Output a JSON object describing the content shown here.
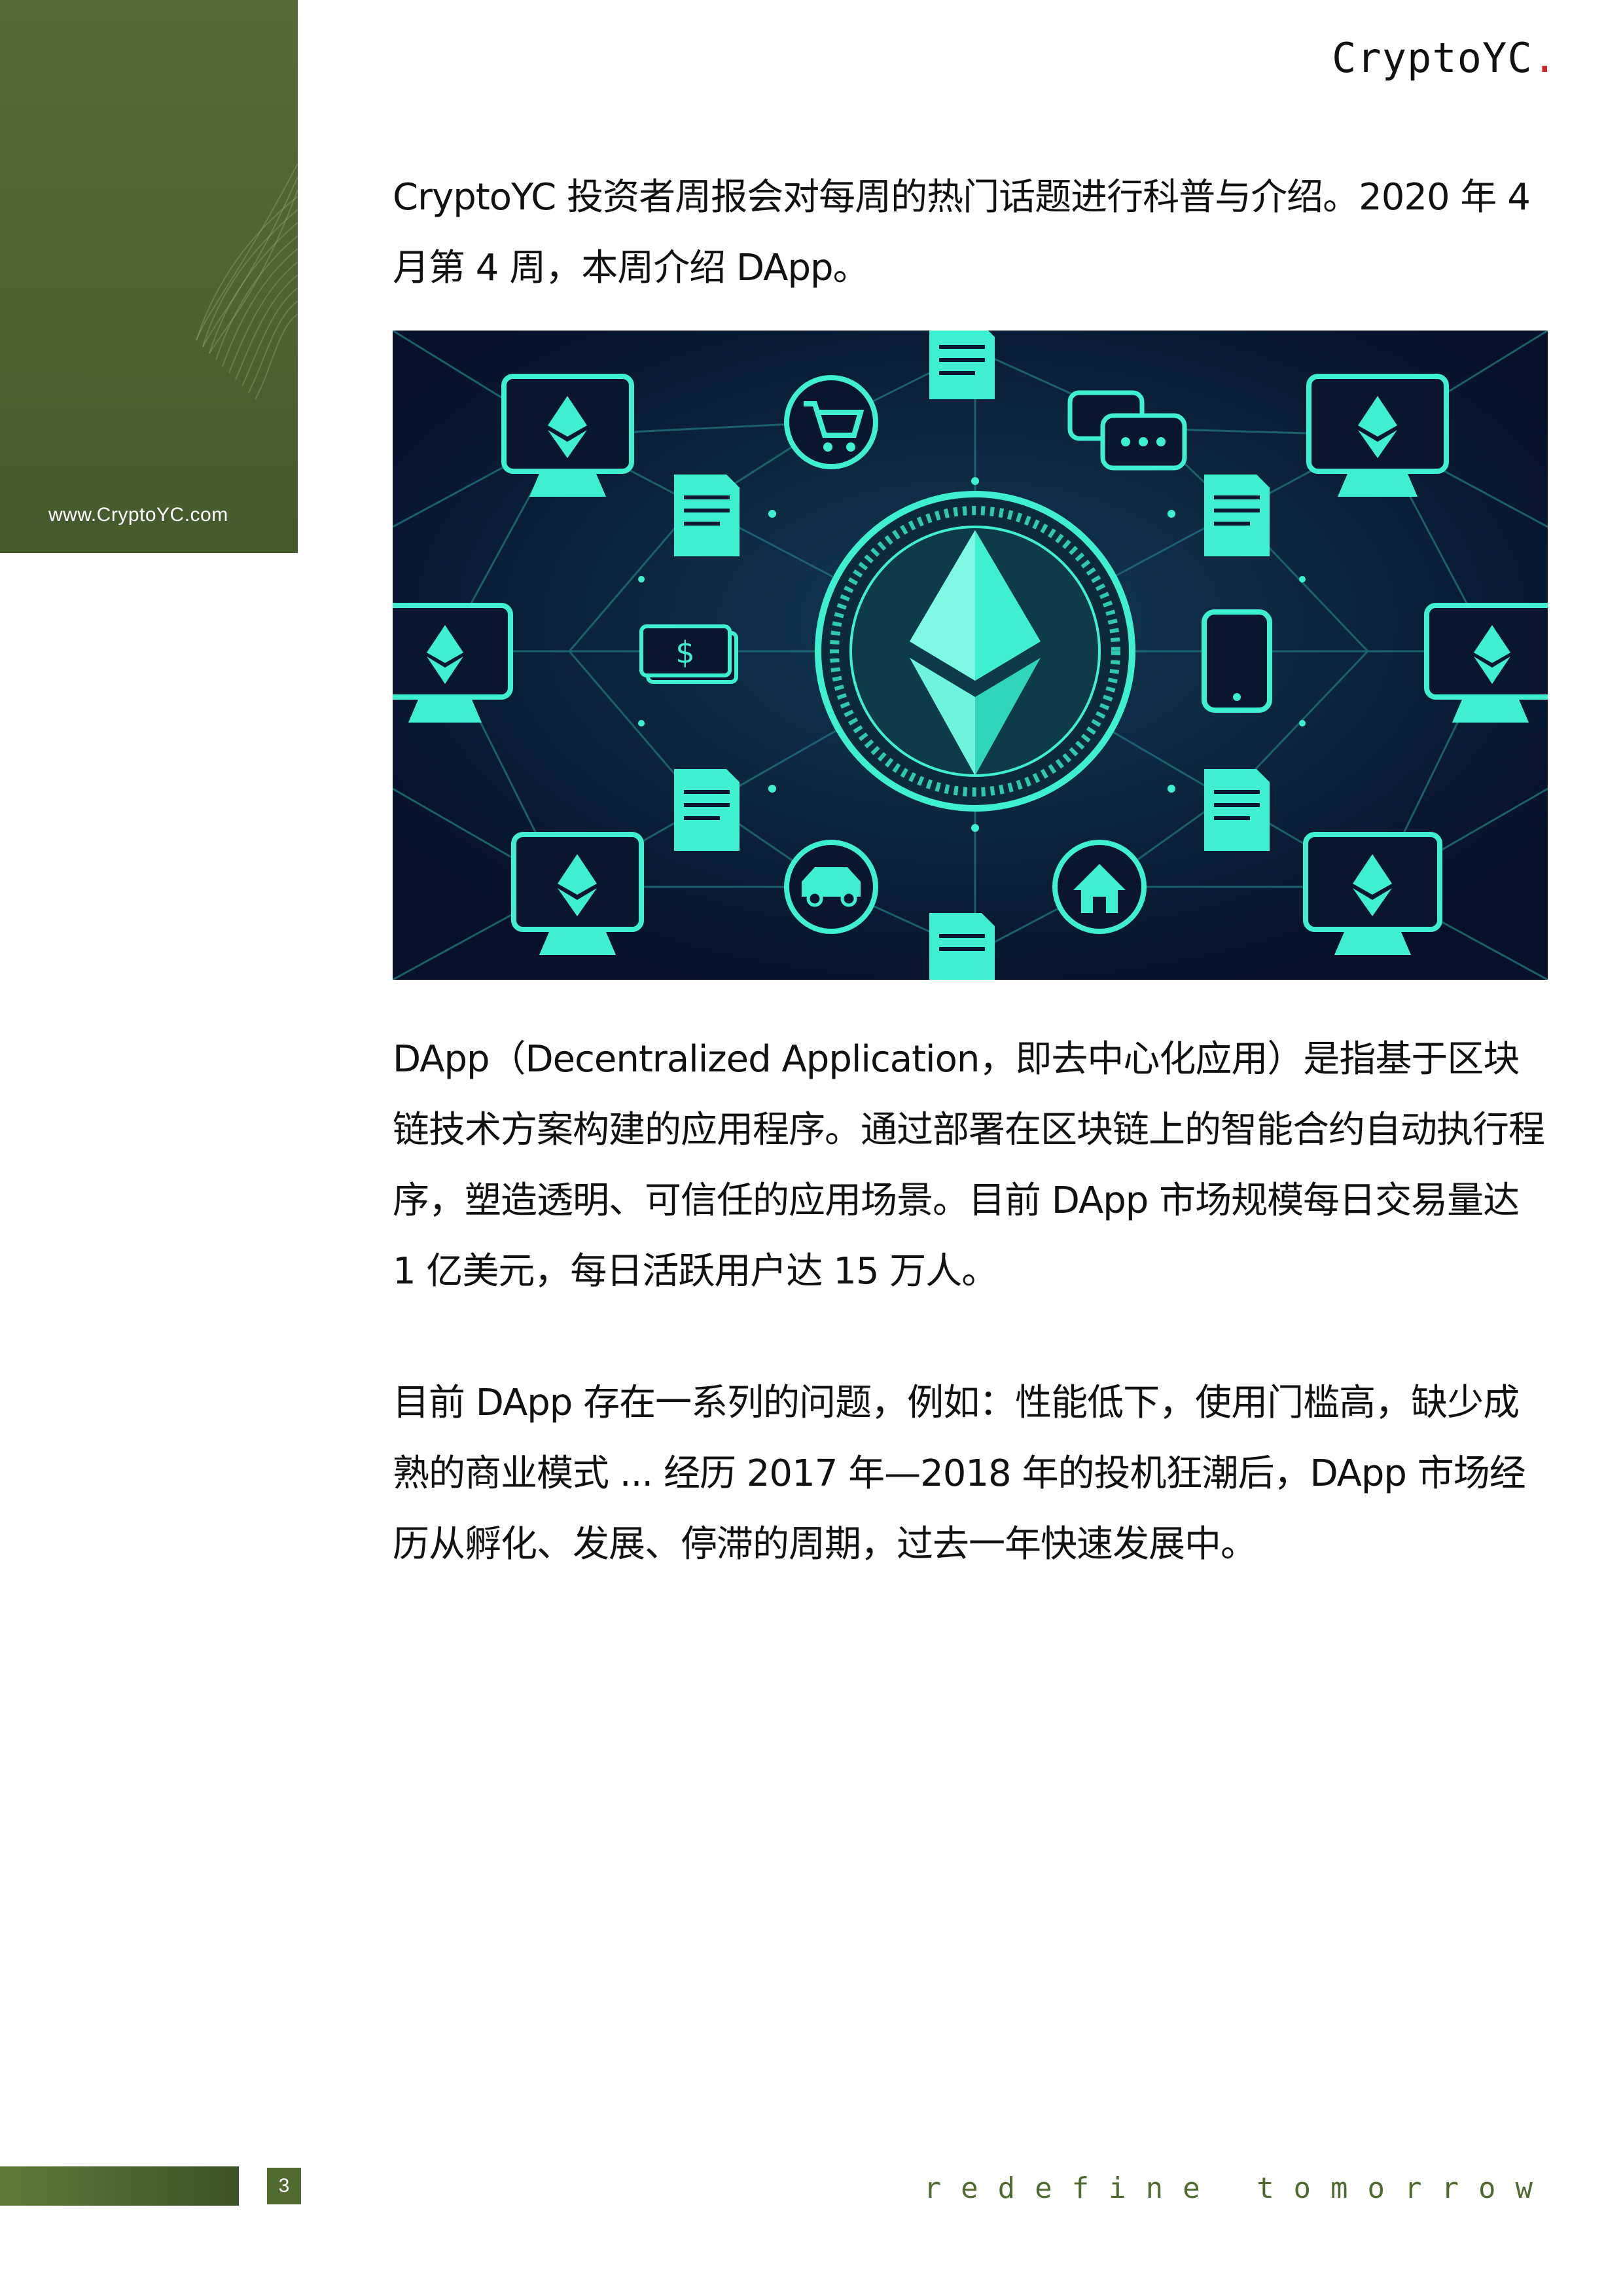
{
  "sidebar": {
    "url": "www.CryptoYC.com"
  },
  "header": {
    "brand": "CryptoYC",
    "brand_dot": "."
  },
  "body": {
    "intro": "CryptoYC 投资者周报会对每周的热门话题进行科普与介绍。2020 年 4 月第 4 周，本周介绍 DApp。",
    "p1": "DApp（Decentralized Application，即去中心化应用）是指基于区块链技术方案构建的应用程序。通过部署在区块链上的智能合约自动执行程序，塑造透明、可信任的应用场景。目前 DApp 市场规模每日交易量达 1 亿美元，每日活跃用户达 15 万人。",
    "p2": "目前 DApp 存在一系列的问题，例如：性能低下，使用门槛高，缺少成熟的商业模式 ... 经历 2017 年—2018 年的投机狂潮后，DApp 市场经历从孵化、发展、停滞的周期，过去一年快速发展中。"
  },
  "illustration": {
    "dollar_symbol": "$"
  },
  "footer": {
    "page_number": "3",
    "tagline": "redefine tomorrow"
  },
  "colors": {
    "brand_green": "#4f6b2f",
    "accent_red": "#d0252a",
    "neon": "#3ff0d0",
    "navy": "#0a1530"
  }
}
